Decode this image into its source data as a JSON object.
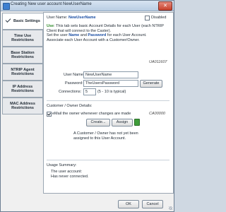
{
  "window": {
    "title": "Creating New user account NewUserName",
    "close_glyph": "✕"
  },
  "tabs": [
    {
      "label": "Basic Settings",
      "active": true
    },
    {
      "label": "Time Use Restrictions"
    },
    {
      "label": "Base Station Restrictions"
    },
    {
      "label": "NTRIP Agent Restrictions"
    },
    {
      "label": "IP Address Restrictions"
    },
    {
      "label": "MAC Address Restrictions"
    }
  ],
  "header": {
    "user_name_label": "User Name:",
    "user_name_value": "NewUserName",
    "disabled_label": "Disabled"
  },
  "intro": {
    "use_word": "Use",
    "line1_rest": ": This tab sets basic Account Details for each User (each NTRIP Client that will connect to the Caster).",
    "line2_a": "Set the user ",
    "name_word": "Name",
    "and_word": " and ",
    "password_word": "Password",
    "line2_b": " for each User Account.",
    "line3": "Associate each User Account with a Customer/Owner."
  },
  "account_id": "UA011607",
  "form": {
    "user_name_label": "User Name:",
    "user_name_value": "NewUserName",
    "password_label": "Password:",
    "password_value": "TheUsersPassword",
    "generate_label": "Generate",
    "connections_label": "Connections:",
    "connections_value": "5",
    "connections_hint": "(5 - 10 is typical)"
  },
  "owner": {
    "section_label": "Customer / Owner Details:",
    "email_label": "eMail the owner whenever changes are made",
    "owner_id": "CA00000",
    "create_label": "Create...",
    "assign_label": "Assign",
    "note_line1": "A Customer / Owner has not yet been",
    "note_line2": "assigned to this User Account."
  },
  "usage": {
    "section_label": "Usage Summary:",
    "line1": "The user account:",
    "line2": "Has never connected."
  },
  "footer": {
    "ok_label": "OK",
    "cancel_label": "Cancel"
  },
  "colors": {
    "accent_blue": "#1a4ea3",
    "green": "#3f9d3a"
  }
}
